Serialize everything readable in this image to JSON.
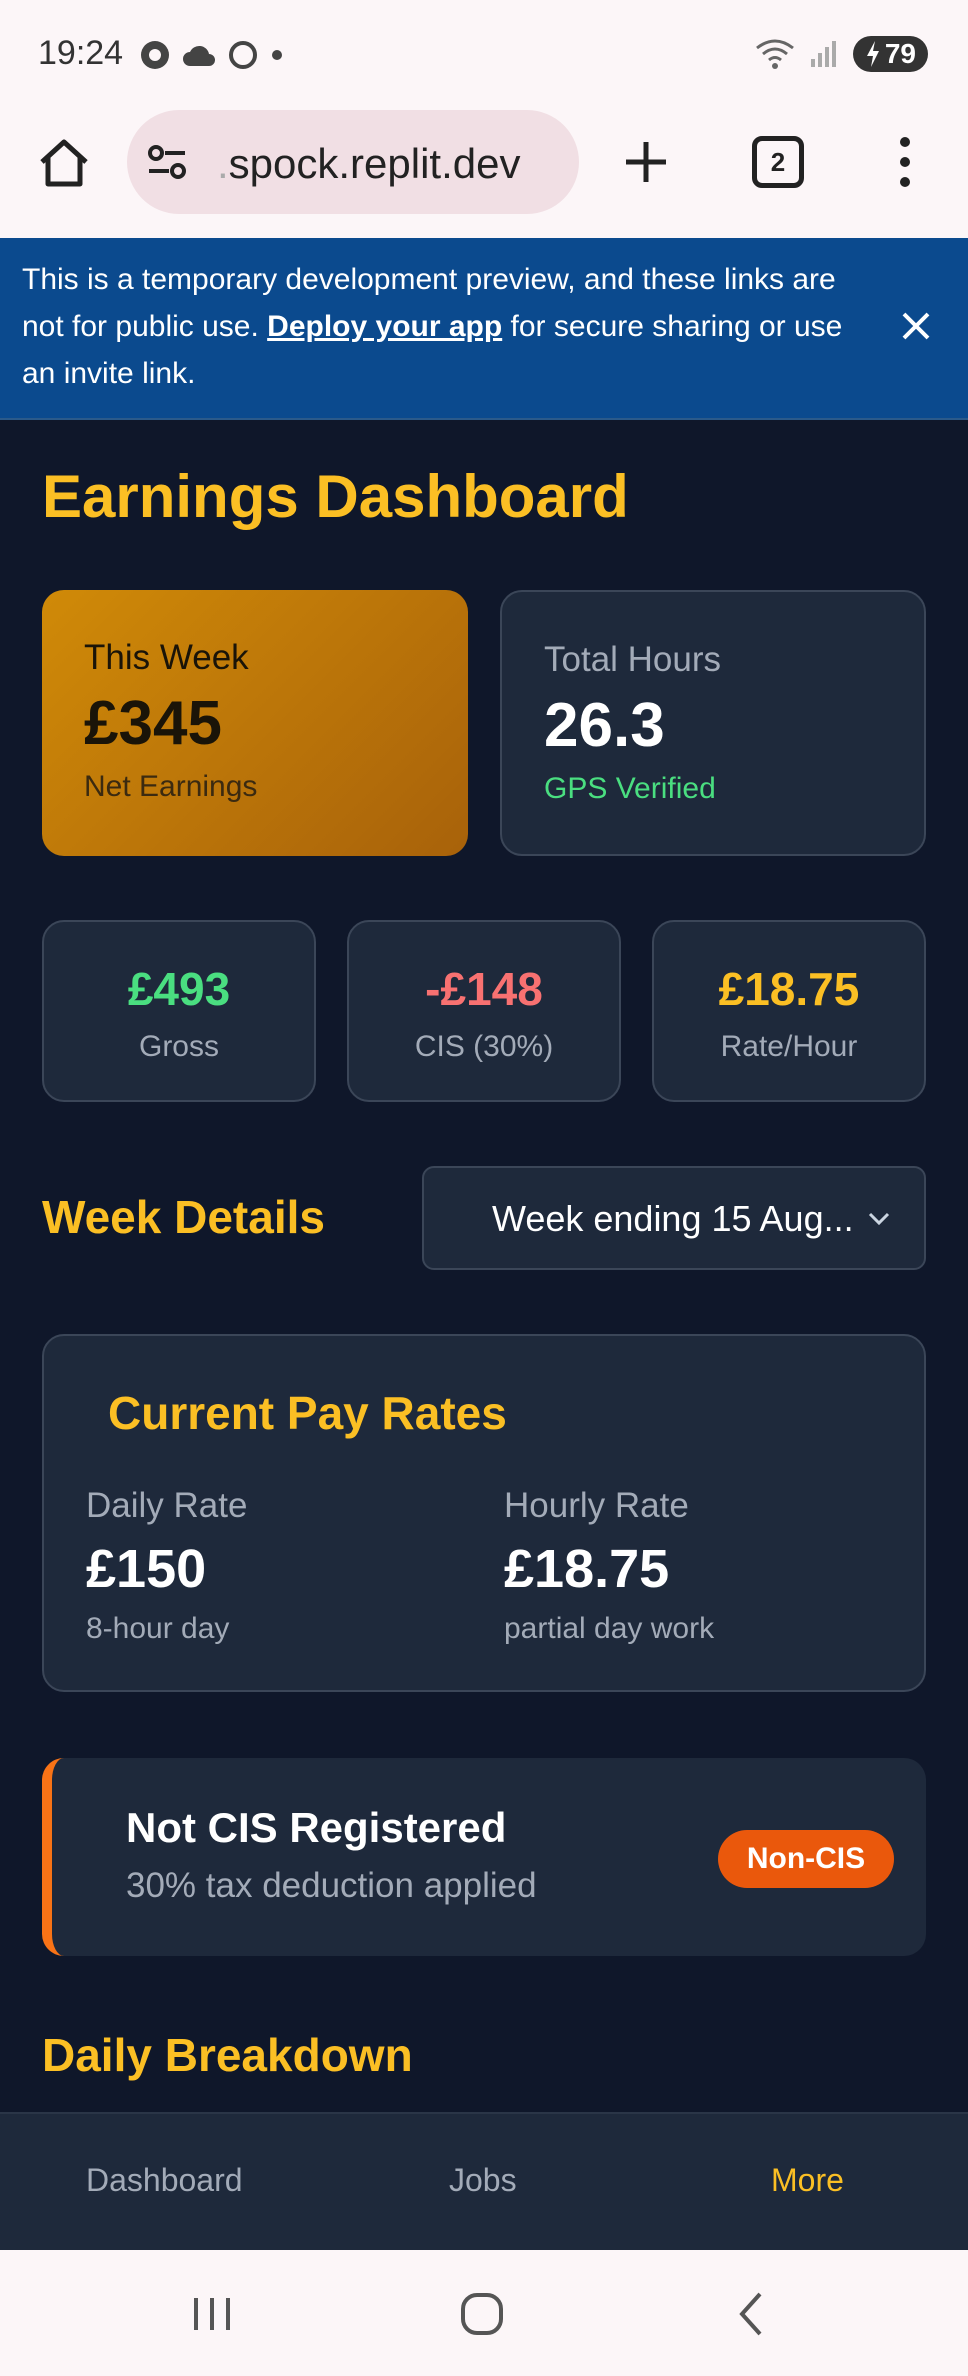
{
  "status_bar": {
    "time": "19:24",
    "battery": "79"
  },
  "browser": {
    "url_prefix": ".",
    "url": "spock.replit.dev",
    "tab_count": "2"
  },
  "banner": {
    "text_before": "This is a temporary development preview, and these links are not for public use. ",
    "link": "Deploy your app",
    "text_after": " for secure sharing or use an invite link."
  },
  "page": {
    "title": "Earnings Dashboard"
  },
  "summary": {
    "week_label": "This Week",
    "week_value": "£345",
    "week_sub": "Net Earnings",
    "hours_label": "Total Hours",
    "hours_value": "26.3",
    "hours_sub": "GPS Verified"
  },
  "stats": [
    {
      "value": "£493",
      "label": "Gross",
      "color": "#4ade80"
    },
    {
      "value": "-£148",
      "label": "CIS (30%)",
      "color": "#f87171"
    },
    {
      "value": "£18.75",
      "label": "Rate/Hour",
      "color": "#fbbf24"
    }
  ],
  "week_details": {
    "title": "Week Details",
    "selected": "Week ending 15 Aug..."
  },
  "pay_rates": {
    "title": "Current Pay Rates",
    "daily_label": "Daily Rate",
    "daily_value": "£150",
    "daily_sub": "8-hour day",
    "hourly_label": "Hourly Rate",
    "hourly_value": "£18.75",
    "hourly_sub": "partial day work"
  },
  "cis": {
    "title": "Not CIS Registered",
    "sub": "30% tax deduction applied",
    "badge": "Non-CIS"
  },
  "daily_breakdown": {
    "title": "Daily Breakdown"
  },
  "bottom_nav": {
    "items": [
      "Dashboard",
      "Jobs",
      "More"
    ],
    "active": "More"
  },
  "colors": {
    "accent": "#fbbf24",
    "background": "#0f172a",
    "card": "#1e293b",
    "banner": "#0b4a8e"
  }
}
